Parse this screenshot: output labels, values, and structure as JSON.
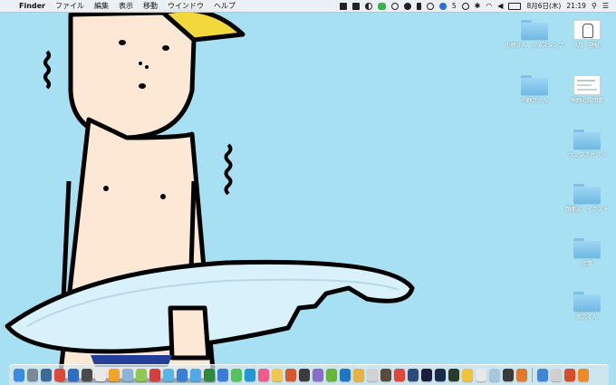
{
  "menubar": {
    "apple_glyph": "",
    "app_name": "Finder",
    "menus": [
      "ファイル",
      "編集",
      "表示",
      "移動",
      "ウインドウ",
      "ヘルプ"
    ],
    "badge_count": "5",
    "date": "8月6日(木)",
    "time": "21:19",
    "tray_icons": [
      "evernote-icon",
      "dropbox-icon",
      "half-circle-icon",
      "line-icon",
      "ring-icon",
      "alert-icon",
      "bookmark-icon",
      "info-icon",
      "vpn-icon",
      "time-machine-icon",
      "bluetooth-icon",
      "wifi-icon",
      "volume-icon",
      "battery-icon"
    ]
  },
  "desktop_icons": [
    {
      "label": "小野さん　lineスタンプ",
      "kind": "folder"
    },
    {
      "label": "8月　壁紙",
      "kind": "doc"
    },
    {
      "label": "小野寺さん",
      "kind": "folder"
    },
    {
      "label": "熊野の説明書",
      "kind": "doc"
    },
    {
      "label": "ウェブマガジン",
      "kind": "folder"
    },
    {
      "label": "顔面式　イラスト",
      "kind": "folder"
    },
    {
      "label": "仕事",
      "kind": "folder"
    },
    {
      "label": "武志くん",
      "kind": "folder"
    }
  ],
  "dock": {
    "colors": [
      "#3b8be0",
      "#7a8a95",
      "#3d6b99",
      "#e0483c",
      "#2c6fc9",
      "#4a4a4a",
      "#e9e9e9",
      "#f4a32a",
      "#8ab4d8",
      "#8fc94f",
      "#d93c3c",
      "#59b7e8",
      "#3b7fd6",
      "#4fa9e8",
      "#2d8a3a",
      "#3a7bd5",
      "#54c35a",
      "#2396d8",
      "#f25a8b",
      "#f0c94c",
      "#d6592c",
      "#3c3c3c",
      "#8a6dc9",
      "#6bb536",
      "#1e76c7",
      "#e7b23d",
      "#d2d2d2",
      "#5a4a3a",
      "#e4453a",
      "#2b4a7a",
      "#1b1b3a",
      "#1a2b4a",
      "#2b3b2b",
      "#f2c23a",
      "#e8e8e8",
      "#a8c8e0",
      "#3a3a3a",
      "#e07a2a",
      "#3f86d6",
      "#cfcfcf",
      "#d94b2b",
      "#f08a24"
    ]
  }
}
